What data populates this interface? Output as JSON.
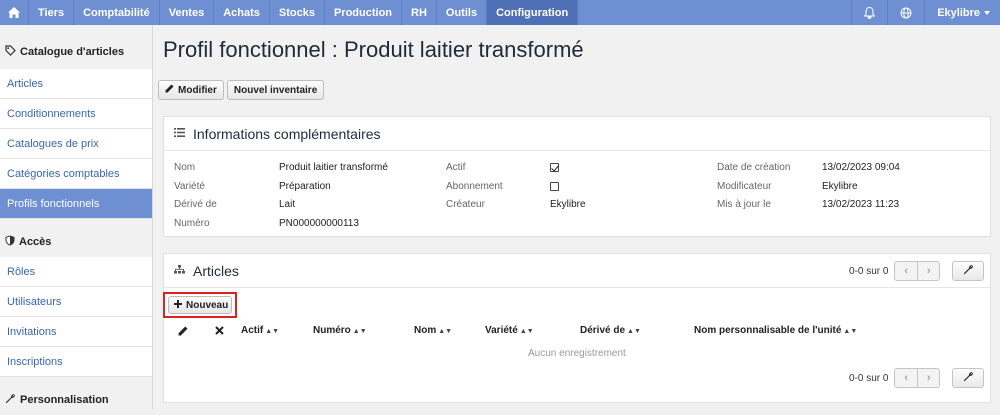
{
  "topnav": {
    "items": [
      "Tiers",
      "Comptabilité",
      "Ventes",
      "Achats",
      "Stocks",
      "Production",
      "RH",
      "Outils",
      "Configuration"
    ],
    "active": "Configuration",
    "user": "Ekylibre"
  },
  "sidebar": {
    "sections": [
      {
        "title": "Catalogue d'articles",
        "items": [
          "Articles",
          "Conditionnements",
          "Catalogues de prix",
          "Catégories comptables",
          "Profils fonctionnels"
        ]
      },
      {
        "title": "Accès",
        "items": [
          "Rôles",
          "Utilisateurs",
          "Invitations",
          "Inscriptions"
        ]
      },
      {
        "title": "Personnalisation",
        "items": []
      }
    ],
    "active_item": "Profils fonctionnels"
  },
  "page": {
    "title": "Profil fonctionnel : Produit laitier transformé"
  },
  "toolbar": {
    "edit_label": "Modifier",
    "inventory_label": "Nouvel inventaire"
  },
  "info": {
    "title": "Informations complémentaires",
    "col1": [
      {
        "label": "Nom",
        "value": "Produit laitier transformé"
      },
      {
        "label": "Variété",
        "value": "Préparation"
      },
      {
        "label": "Dérivé de",
        "value": "Lait"
      },
      {
        "label": "Numéro",
        "value": "PN000000000113"
      }
    ],
    "col2": [
      {
        "label": "Actif",
        "checked": true
      },
      {
        "label": "Abonnement",
        "checked": false
      },
      {
        "label": "Créateur",
        "value": "Ekylibre"
      }
    ],
    "col3": [
      {
        "label": "Date de création",
        "value": "13/02/2023 09:04"
      },
      {
        "label": "Modificateur",
        "value": "Ekylibre"
      },
      {
        "label": "Mis à jour le",
        "value": "13/02/2023 11:23"
      }
    ]
  },
  "articles": {
    "title": "Articles",
    "pager_text": "0-0 sur 0",
    "new_label": "Nouveau",
    "columns": [
      "Actif",
      "Numéro",
      "Nom",
      "Variété",
      "Dérivé de",
      "Nom personnalisable de l'unité"
    ],
    "empty_text": "Aucun enregistrement"
  },
  "icons": {
    "home": "home-icon",
    "bell": "bell-icon",
    "globe": "globe-icon",
    "catalog": "tags-icon",
    "access": "shield-icon",
    "custom": "wrench-icon",
    "list": "list-icon",
    "sitemap": "sitemap-icon"
  },
  "colors": {
    "nav": "#6e8fd2",
    "nav_active": "#4f6fb6",
    "link": "#3a66b5",
    "highlight": "#d9241f"
  }
}
